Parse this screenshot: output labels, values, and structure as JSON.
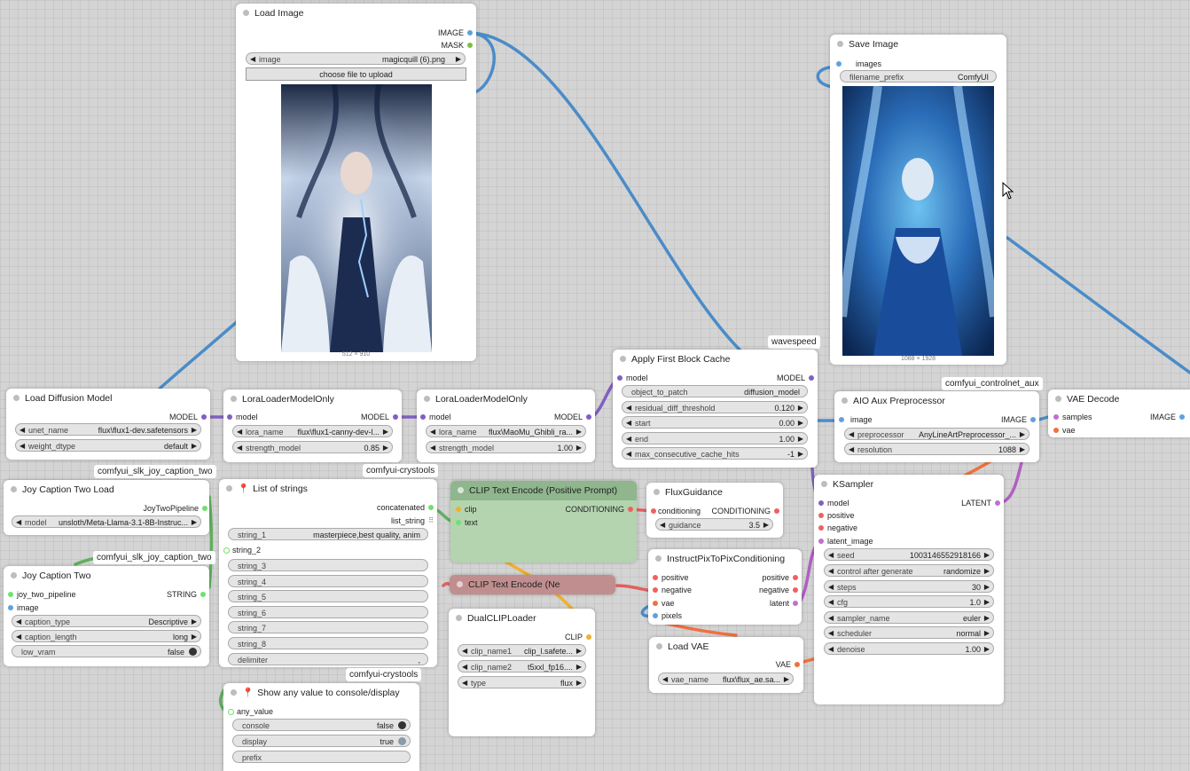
{
  "colors": {
    "model": "#8060c0",
    "image": "#60a0e0",
    "mask": "#80c040",
    "string": "#70e070",
    "conditioning": "#f06060",
    "clip": "#f0b030",
    "latent": "#c070d0",
    "vae": "#f07040",
    "pipeline": "#70e070",
    "wire_image": "#4a8cc8",
    "wire_model": "#8060c0",
    "wire_latent": "#b060c0",
    "wire_clip": "#f0b030",
    "wire_string": "#60b060",
    "wire_vae": "#f07040",
    "wire_cond": "#e06060"
  },
  "load_image": {
    "title": "Load Image",
    "out_image": "IMAGE",
    "out_mask": "MASK",
    "image_label": "image",
    "image_value": "magicquill (6).png",
    "upload": "choose file to upload",
    "size": "512 × 910"
  },
  "save_image": {
    "title": "Save Image",
    "in_images": "images",
    "prefix_label": "filename_prefix",
    "prefix_value": "ComfyUI",
    "size": "1088 × 1928"
  },
  "load_diffusion": {
    "title": "Load Diffusion Model",
    "out_model": "MODEL",
    "unet_label": "unet_name",
    "unet_value": "flux\\flux1-dev.safetensors",
    "dtype_label": "weight_dtype",
    "dtype_value": "default"
  },
  "lora1": {
    "title": "LoraLoaderModelOnly",
    "in_model": "model",
    "out_model": "MODEL",
    "lora_label": "lora_name",
    "lora_value": "flux\\flux1-canny-dev-l...",
    "strength_label": "strength_model",
    "strength_value": "0.85"
  },
  "lora2": {
    "title": "LoraLoaderModelOnly",
    "in_model": "model",
    "out_model": "MODEL",
    "lora_label": "lora_name",
    "lora_value": "flux\\MaoMu_Ghibli_ra...",
    "strength_label": "strength_model",
    "strength_value": "1.00"
  },
  "wavespeed_badge": "wavespeed",
  "apply_cache": {
    "title": "Apply First Block Cache",
    "in_model": "model",
    "out_model": "MODEL",
    "obj_label": "object_to_patch",
    "obj_value": "diffusion_model",
    "rdt_label": "residual_diff_threshold",
    "rdt_value": "0.120",
    "start_label": "start",
    "start_value": "0.00",
    "end_label": "end",
    "end_value": "1.00",
    "max_label": "max_consecutive_cache_hits",
    "max_value": "-1"
  },
  "controlnet_badge": "comfyui_controlnet_aux",
  "aio": {
    "title": "AIO Aux Preprocessor",
    "in_image": "image",
    "out_image": "IMAGE",
    "pre_label": "preprocessor",
    "pre_value": "AnyLineArtPreprocessor_...",
    "res_label": "resolution",
    "res_value": "1088"
  },
  "vae_decode": {
    "title": "VAE Decode",
    "in_samples": "samples",
    "in_vae": "vae",
    "out_image": "IMAGE"
  },
  "joy_badge1": "comfyui_slk_joy_caption_two",
  "joy_load": {
    "title": "Joy Caption Two Load",
    "out": "JoyTwoPipeline",
    "model_label": "model",
    "model_value": "unsloth/Meta-Llama-3.1-8B-Instruc..."
  },
  "joy_badge2": "comfyui_slk_joy_caption_two",
  "joy_two": {
    "title": "Joy Caption Two",
    "in_pipeline": "joy_two_pipeline",
    "in_image": "image",
    "out": "STRING",
    "ct_label": "caption_type",
    "ct_value": "Descriptive",
    "cl_label": "caption_length",
    "cl_value": "long",
    "lv_label": "low_vram",
    "lv_value": "false"
  },
  "crystools_badge1": "comfyui-crystools",
  "list_strings": {
    "title": "List of strings",
    "out1": "concatenated",
    "out2": "list_string",
    "s1_label": "string_1",
    "s1_value": "masterpiece,best quality, anim",
    "s2": "string_2",
    "s3": "string_3",
    "s4": "string_4",
    "s5": "string_5",
    "s6": "string_6",
    "s7": "string_7",
    "s8": "string_8",
    "delim_label": "delimiter",
    "delim_value": ","
  },
  "crystools_badge2": "comfyui-crystools",
  "show_any": {
    "title": "Show any value to console/display",
    "in": "any_value",
    "console_label": "console",
    "console_value": "false",
    "display_label": "display",
    "display_value": "true",
    "prefix_label": "prefix"
  },
  "clip_pos": {
    "title": "CLIP Text Encode (Positive Prompt)",
    "in_clip": "clip",
    "in_text": "text",
    "out": "CONDITIONING"
  },
  "clip_neg": {
    "title": "CLIP Text Encode (Ne"
  },
  "dual_clip": {
    "title": "DualCLIPLoader",
    "out": "CLIP",
    "c1_label": "clip_name1",
    "c1_value": "clip_l.safete...",
    "c2_label": "clip_name2",
    "c2_value": "t5xxl_fp16....",
    "type_label": "type",
    "type_value": "flux"
  },
  "flux_guidance": {
    "title": "FluxGuidance",
    "in": "conditioning",
    "out": "CONDITIONING",
    "g_label": "guidance",
    "g_value": "3.5"
  },
  "instruct": {
    "title": "InstructPixToPixConditioning",
    "in_pos": "positive",
    "in_neg": "negative",
    "in_vae": "vae",
    "in_pixels": "pixels",
    "out_pos": "positive",
    "out_neg": "negative",
    "out_latent": "latent"
  },
  "load_vae": {
    "title": "Load VAE",
    "out": "VAE",
    "vae_label": "vae_name",
    "vae_value": "flux\\flux_ae.sa..."
  },
  "ksampler": {
    "title": "KSampler",
    "in_model": "model",
    "in_pos": "positive",
    "in_neg": "negative",
    "in_latent": "latent_image",
    "out": "LATENT",
    "seed_label": "seed",
    "seed_value": "1003146552918166",
    "cag_label": "control after generate",
    "cag_value": "randomize",
    "steps_label": "steps",
    "steps_value": "30",
    "cfg_label": "cfg",
    "cfg_value": "1.0",
    "sampler_label": "sampler_name",
    "sampler_value": "euler",
    "sched_label": "scheduler",
    "sched_value": "normal",
    "denoise_label": "denoise",
    "denoise_value": "1.00"
  }
}
